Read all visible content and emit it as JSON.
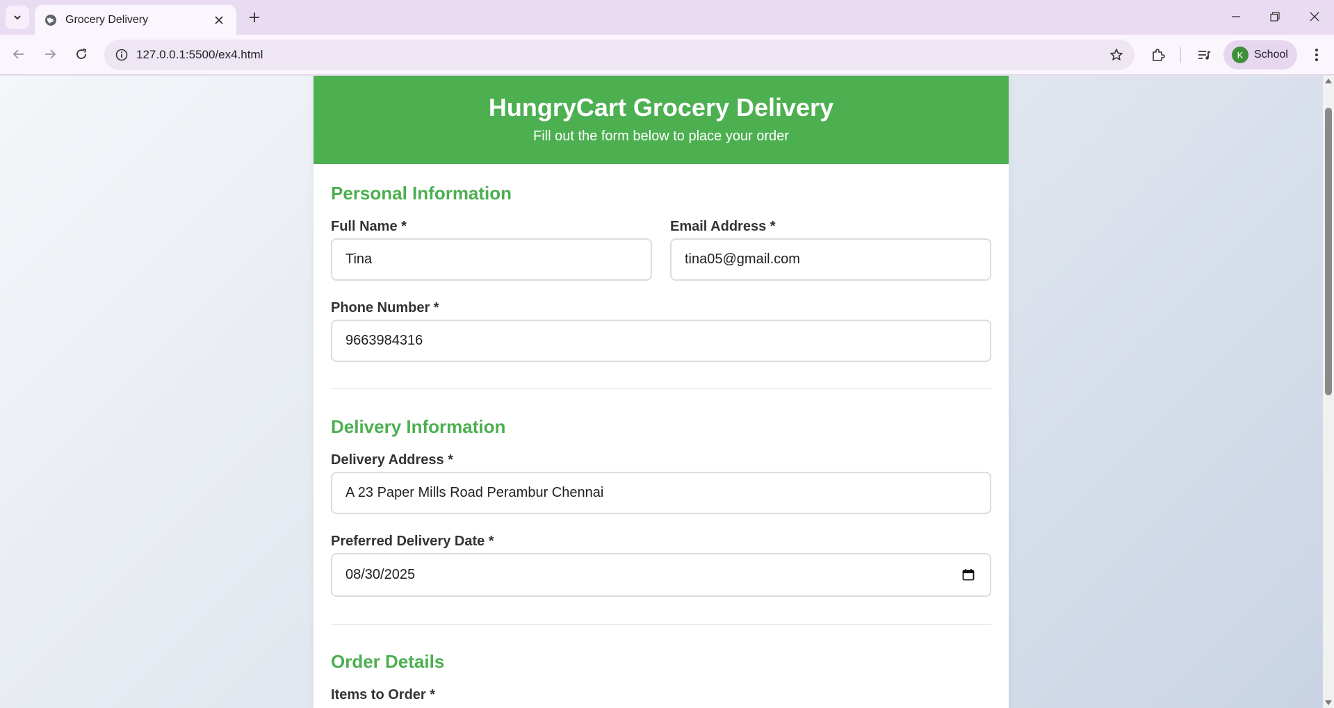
{
  "browser": {
    "tab_title": "Grocery Delivery",
    "url": "127.0.0.1:5500/ex4.html",
    "profile_initial": "K",
    "profile_name": "School"
  },
  "colors": {
    "accent": "#4caf50",
    "tabstrip": "#e9dcf2"
  },
  "header": {
    "title": "HungryCart Grocery Delivery",
    "subtitle": "Fill out the form below to place your order"
  },
  "personal": {
    "section_title": "Personal Information",
    "full_name_label": "Full Name *",
    "full_name_value": "Tina",
    "email_label": "Email Address *",
    "email_value": "tina05@gmail.com",
    "phone_label": "Phone Number *",
    "phone_value": "9663984316"
  },
  "delivery": {
    "section_title": "Delivery Information",
    "address_label": "Delivery Address *",
    "address_value": "A 23 Paper Mills Road Perambur Chennai",
    "date_label": "Preferred Delivery Date *",
    "date_value": "08/30/2025"
  },
  "order": {
    "section_title": "Order Details",
    "items_label": "Items to Order *"
  },
  "icons": [
    "tab-search-icon",
    "globe-icon",
    "close-icon",
    "plus-icon",
    "minimize-icon",
    "restore-icon",
    "window-close-icon",
    "back-icon",
    "forward-icon",
    "reload-icon",
    "info-icon",
    "star-icon",
    "extensions-icon",
    "media-icon",
    "menu-icon",
    "calendar-icon"
  ]
}
